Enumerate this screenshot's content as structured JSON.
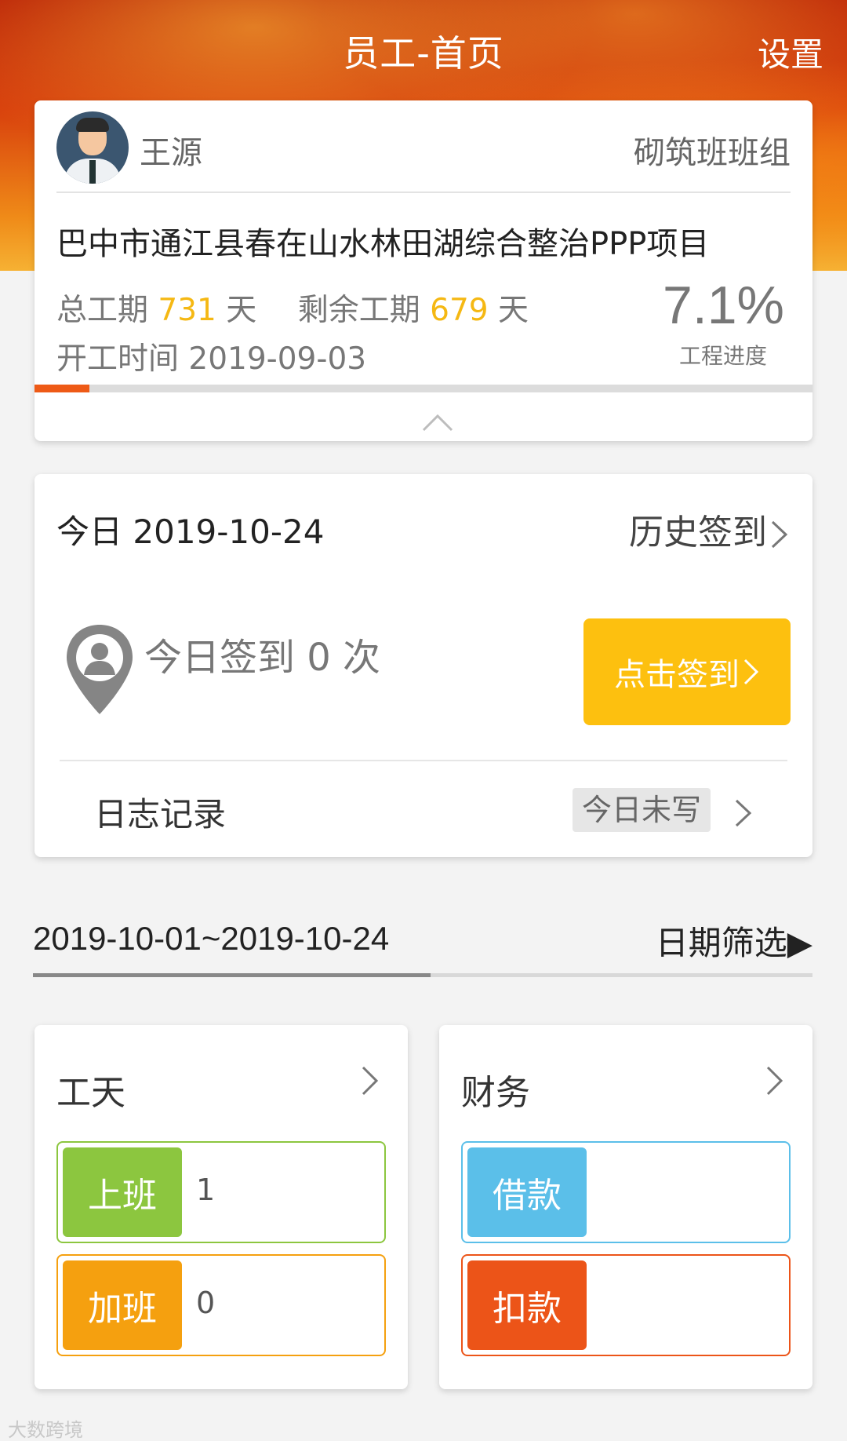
{
  "header": {
    "title": "员工-首页",
    "settings_label": "设置"
  },
  "profile": {
    "user_name": "王源",
    "team": "砌筑班班组",
    "project": "巴中市通江县春在山水林田湖综合整治PPP项目",
    "total_period_label": "总工期",
    "total_period_value": "731",
    "remaining_period_label": "剩余工期",
    "remaining_period_value": "679",
    "day_unit": "天",
    "start_label": "开工时间",
    "start_date": "2019-09-03",
    "progress_text": "7.1%",
    "progress_fraction": 0.071,
    "progress_label": "工程进度"
  },
  "signin": {
    "today_label": "今日",
    "today_date": "2019-10-24",
    "history_label": "历史签到",
    "count_text": "今日签到 0 次",
    "button_label": "点击签到",
    "log_label": "日志记录",
    "log_status": "今日未写"
  },
  "range": {
    "text": "2019-10-01~2019-10-24",
    "filter_label": "日期筛选▶",
    "fill_fraction": 0.51
  },
  "workdays": {
    "title": "工天",
    "rows": [
      {
        "label": "上班",
        "value": "1",
        "color": "#8cc63f"
      },
      {
        "label": "加班",
        "value": "0",
        "color": "#f5a00f"
      }
    ]
  },
  "finance": {
    "title": "财务",
    "rows": [
      {
        "label": "借款",
        "value": "",
        "color": "#5bbfe9"
      },
      {
        "label": "扣款",
        "value": "",
        "color": "#ec5418"
      }
    ]
  },
  "colors": {
    "accent_orange": "#ee5a16",
    "highlight_yellow": "#f5b813",
    "button_yellow": "#fdc00f"
  },
  "watermark": "大数跨境"
}
